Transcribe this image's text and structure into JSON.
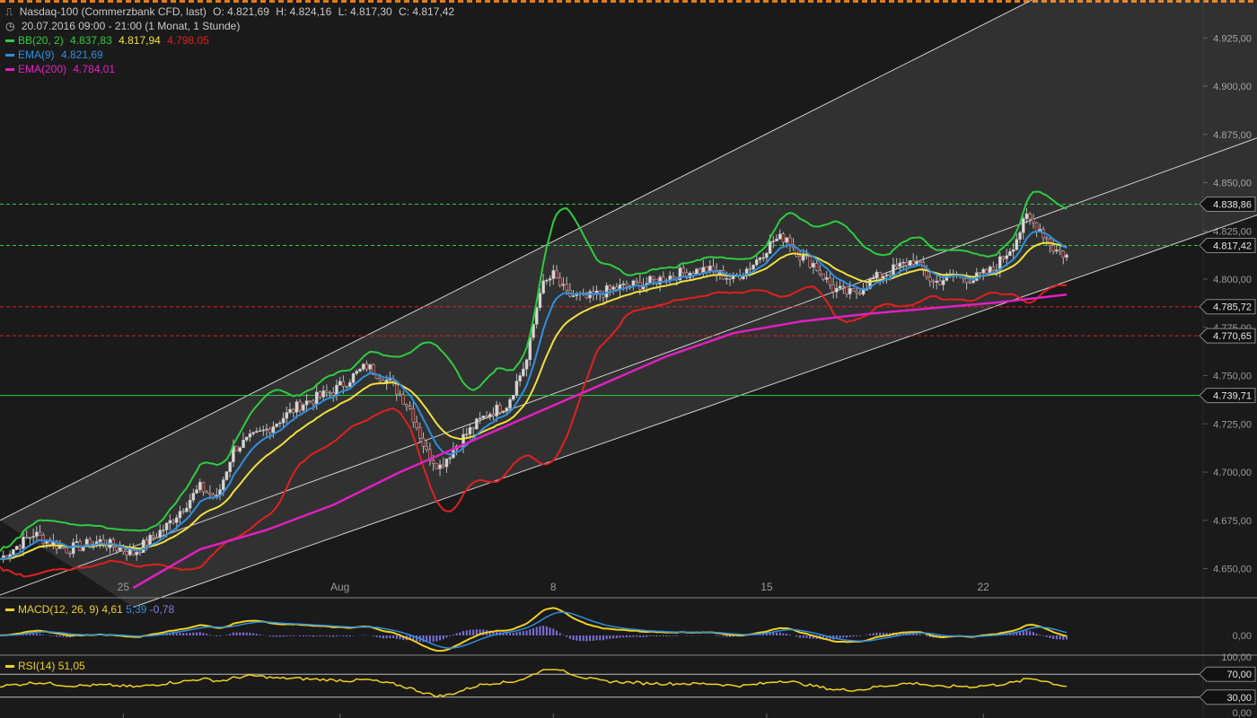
{
  "header": {
    "instrument": "Nasdaq-100 (Commerzbank CFD, last)",
    "ohlc": {
      "o": "O: 4.821,69",
      "h": "H: 4.824,16",
      "l": "L: 4.817,30",
      "c": "C: 4.817,42"
    },
    "period": "20.07.2016 09:00 - 21:00 (1 Monat, 1 Stunde)"
  },
  "indicators": {
    "bb": {
      "label": "BB(20, 2)",
      "mid": "4.837,83",
      "upper": "4.817,94",
      "lower": "4.798,05",
      "color": "#2ecc40",
      "upper_color": "#f0e040",
      "lower_color": "#e02020"
    },
    "ema9": {
      "label": "EMA(9)",
      "value": "4.821,69",
      "color": "#2f8fdf"
    },
    "ema200": {
      "label": "EMA(200)",
      "value": "4.784,01",
      "color": "#e020c0"
    }
  },
  "macd": {
    "label": "MACD(12, 26, 9)",
    "v1": "4,61",
    "v2": "5,39",
    "v3": "-0,78"
  },
  "rsi": {
    "label": "RSI(14)",
    "value": "51,05"
  },
  "chart_data": {
    "type": "candlestick",
    "x_tick_labels": [
      "25",
      "Aug",
      "8",
      "15",
      "22"
    ],
    "y_axis_labels": [
      "4.925,00",
      "4.900,00",
      "4.875,00",
      "4.850,00",
      "4.825,00",
      "4.800,00",
      "4.775,00",
      "4.750,00",
      "4.725,00",
      "4.700,00",
      "4.675,00",
      "4.650,00"
    ],
    "ylim": [
      4640,
      4940
    ],
    "price_levels": [
      {
        "label": "4.838,86",
        "value": 4838.86,
        "color": "#2ecc40"
      },
      {
        "label": "4.817,42",
        "value": 4817.42,
        "color": "#2ecc40"
      },
      {
        "label": "4.785,72",
        "value": 4785.72,
        "color": "#e02020"
      },
      {
        "label": "4.770,65",
        "value": 4770.65,
        "color": "#e02020"
      },
      {
        "label": "4.739,71",
        "value": 4739.71,
        "color": "#2ecc40",
        "solid": true
      }
    ],
    "price_path": [
      [
        0,
        4655
      ],
      [
        10,
        4668
      ],
      [
        20,
        4660
      ],
      [
        30,
        4664
      ],
      [
        40,
        4658
      ],
      [
        50,
        4672
      ],
      [
        60,
        4692
      ],
      [
        65,
        4686
      ],
      [
        70,
        4712
      ],
      [
        80,
        4722
      ],
      [
        90,
        4735
      ],
      [
        100,
        4742
      ],
      [
        110,
        4755
      ],
      [
        118,
        4745
      ],
      [
        123,
        4733
      ],
      [
        128,
        4710
      ],
      [
        132,
        4703
      ],
      [
        136,
        4712
      ],
      [
        140,
        4720
      ],
      [
        146,
        4730
      ],
      [
        152,
        4735
      ],
      [
        158,
        4758
      ],
      [
        162,
        4795
      ],
      [
        166,
        4802
      ],
      [
        170,
        4792
      ],
      [
        176,
        4790
      ],
      [
        184,
        4795
      ],
      [
        194,
        4798
      ],
      [
        204,
        4803
      ],
      [
        212,
        4805
      ],
      [
        220,
        4800
      ],
      [
        226,
        4808
      ],
      [
        232,
        4820
      ],
      [
        236,
        4822
      ],
      [
        240,
        4812
      ],
      [
        244,
        4808
      ],
      [
        250,
        4795
      ],
      [
        256,
        4792
      ],
      [
        262,
        4800
      ],
      [
        268,
        4805
      ],
      [
        274,
        4810
      ],
      [
        280,
        4798
      ],
      [
        286,
        4802
      ],
      [
        292,
        4800
      ],
      [
        298,
        4805
      ],
      [
        304,
        4818
      ],
      [
        308,
        4832
      ],
      [
        312,
        4826
      ],
      [
        316,
        4816
      ],
      [
        320,
        4812
      ]
    ],
    "ema200_path": [
      [
        40,
        4640
      ],
      [
        60,
        4660
      ],
      [
        80,
        4670
      ],
      [
        100,
        4683
      ],
      [
        120,
        4700
      ],
      [
        140,
        4715
      ],
      [
        160,
        4730
      ],
      [
        180,
        4745
      ],
      [
        200,
        4760
      ],
      [
        220,
        4772
      ],
      [
        240,
        4778
      ],
      [
        260,
        4782
      ],
      [
        280,
        4785
      ],
      [
        300,
        4788
      ],
      [
        320,
        4792
      ]
    ],
    "channel": {
      "upper": [
        [
          0,
          4675
        ],
        [
          310,
          4945
        ],
        [
          380,
          4945
        ]
      ],
      "lower_a": [
        [
          -10,
          4630
        ],
        [
          380,
          4875
        ]
      ],
      "lower_b": [
        [
          40,
          4630
        ],
        [
          380,
          4835
        ]
      ]
    },
    "rsi_levels": [
      "100,00",
      "70,00",
      "30,00",
      "0,00"
    ],
    "macd_zero_label": "0,00"
  }
}
